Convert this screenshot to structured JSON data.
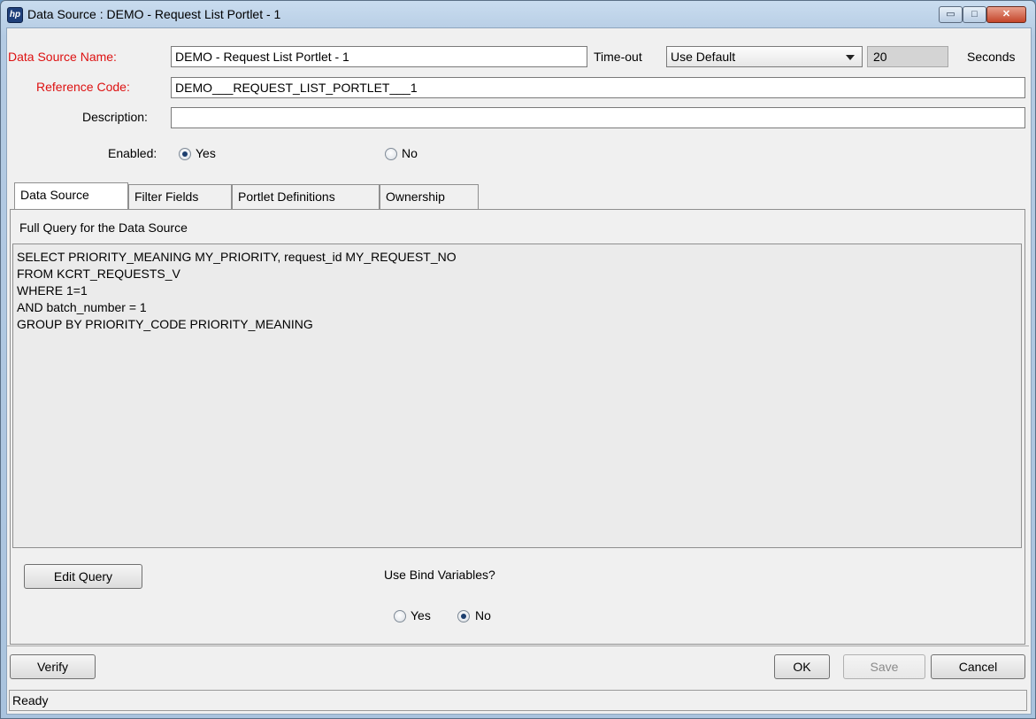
{
  "window": {
    "title": "Data Source : DEMO - Request List Portlet - 1",
    "controls": {
      "minimize": "▭",
      "maximize": "□",
      "close": "✕"
    }
  },
  "form": {
    "name_label": "Data Source Name:",
    "name_value": "DEMO - Request List Portlet - 1",
    "timeout_label": "Time-out",
    "timeout_option": "Use Default",
    "timeout_value": "20",
    "seconds_label": "Seconds",
    "ref_label": "Reference Code:",
    "ref_value": "DEMO___REQUEST_LIST_PORTLET___1",
    "desc_label": "Description:",
    "desc_value": "",
    "enabled_label": "Enabled:",
    "enabled_yes": "Yes",
    "enabled_no": "No",
    "enabled_selected": "Yes"
  },
  "tabs": [
    {
      "label": "Data Source",
      "active": true
    },
    {
      "label": "Filter Fields",
      "active": false
    },
    {
      "label": "Portlet Definitions",
      "active": false
    },
    {
      "label": "Ownership",
      "active": false
    }
  ],
  "panel": {
    "heading": "Full Query for the Data Source",
    "query": "SELECT PRIORITY_MEANING MY_PRIORITY, request_id MY_REQUEST_NO\nFROM KCRT_REQUESTS_V\nWHERE 1=1\nAND batch_number = 1\nGROUP BY PRIORITY_CODE PRIORITY_MEANING",
    "edit_query": "Edit Query",
    "bind_label": "Use Bind Variables?",
    "bind_yes": "Yes",
    "bind_no": "No",
    "bind_selected": "No"
  },
  "buttons": {
    "verify": "Verify",
    "ok": "OK",
    "save": "Save",
    "cancel": "Cancel"
  },
  "status": "Ready",
  "icons": {
    "app": "hp-logo-icon"
  }
}
